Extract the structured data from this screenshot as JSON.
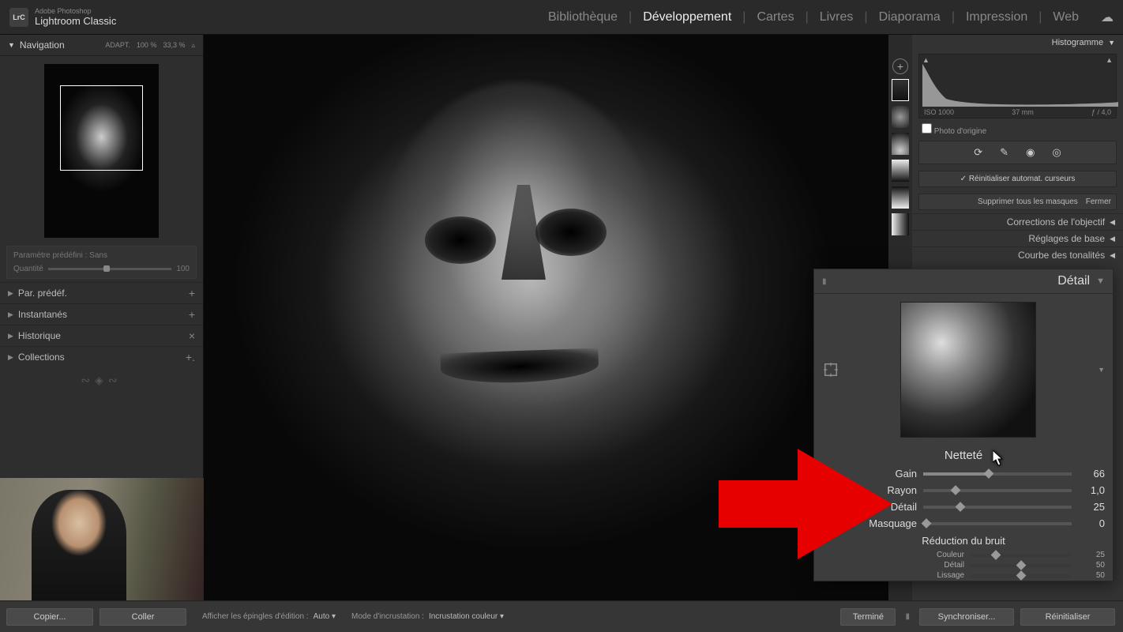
{
  "app": {
    "brand": "Adobe Photoshop",
    "name": "Lightroom Classic",
    "logo": "LrC"
  },
  "modules": {
    "items": [
      "Bibliothèque",
      "Développement",
      "Cartes",
      "Livres",
      "Diaporama",
      "Impression",
      "Web"
    ],
    "activeIndex": 1
  },
  "nav": {
    "title": "Navigation",
    "zoom_mode": "ADAPT.",
    "zoom_100": "100 %",
    "zoom_pct": "33,3 %"
  },
  "preset_box": {
    "label": "Paramètre prédéfini : Sans",
    "quantity_label": "Quantité",
    "quantity_value": "100"
  },
  "left_sections": {
    "presets": "Par. prédéf.",
    "snapshots": "Instantanés",
    "history": "Historique",
    "collections": "Collections"
  },
  "histogram": {
    "title": "Histogramme",
    "iso": "ISO 1000",
    "focal": "37 mm",
    "aperture": "ƒ / 4,0",
    "original": "Photo d'origine"
  },
  "mask_panel": {
    "reset_cursors": "Réinitialiser automat. curseurs",
    "delete_all": "Supprimer tous les masques",
    "close": "Fermer"
  },
  "right_sections": {
    "lens": "Corrections de l'objectif",
    "basic": "Réglages de base",
    "tone": "Courbe des tonalités"
  },
  "detail": {
    "title": "Détail",
    "sharpening_title": "Netteté",
    "gain": {
      "label": "Gain",
      "value": "66",
      "pct": 44
    },
    "radius": {
      "label": "Rayon",
      "value": "1,0",
      "pct": 22
    },
    "detail_slider": {
      "label": "Détail",
      "value": "25",
      "pct": 25
    },
    "masking": {
      "label": "Masquage",
      "value": "0",
      "pct": 0
    },
    "noise_title": "Réduction du bruit",
    "color": {
      "label": "Couleur",
      "value": "25",
      "pct": 25
    },
    "n_detail": {
      "label": "Détail",
      "value": "50",
      "pct": 50
    },
    "smooth": {
      "label": "Lissage",
      "value": "50",
      "pct": 50
    }
  },
  "bottom": {
    "copy": "Copier...",
    "paste": "Coller",
    "pins_label": "Afficher les épingles d'édition :",
    "pins_mode": "Auto",
    "overlay_label": "Mode d'incrustation :",
    "overlay_mode": "Incrustation couleur",
    "done": "Terminé",
    "sync": "Synchroniser...",
    "reset": "Réinitialiser"
  }
}
